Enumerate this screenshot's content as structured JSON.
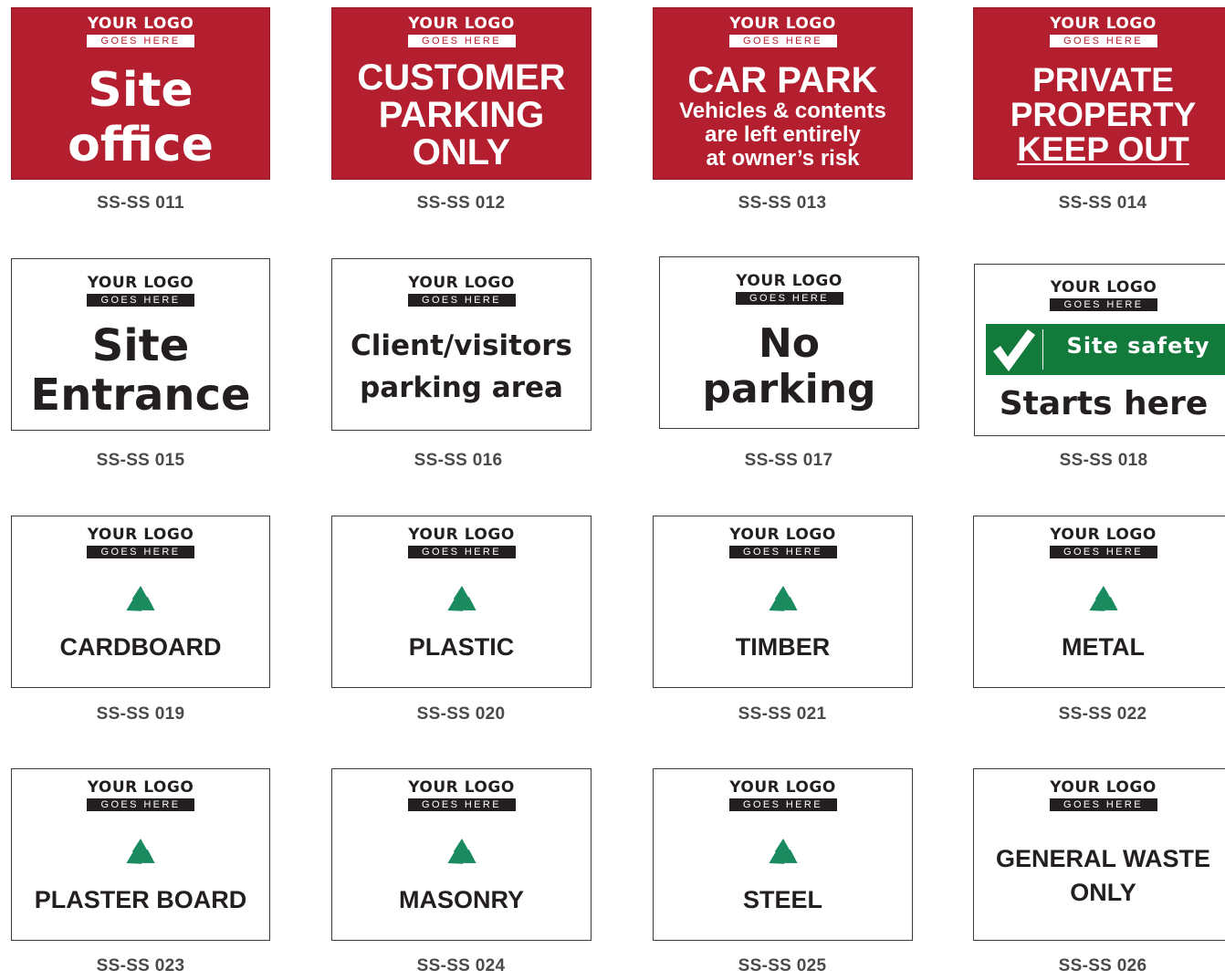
{
  "logo": {
    "line1": "YOUR LOGO",
    "line2": "GOES HERE"
  },
  "colors": {
    "red": "#b41f2f",
    "green": "#127a3b",
    "recycle": "#1a8a5f",
    "text": "#231f20"
  },
  "signs": [
    {
      "code": "SS-SS 011",
      "lines": [
        "Site",
        "office"
      ]
    },
    {
      "code": "SS-SS 012",
      "lines": [
        "CUSTOMER",
        "PARKING",
        "ONLY"
      ]
    },
    {
      "code": "SS-SS 013",
      "lines": [
        "CAR PARK",
        "Vehicles & contents",
        "are left entirely",
        "at owner’s risk"
      ]
    },
    {
      "code": "SS-SS 014",
      "lines": [
        "PRIVATE",
        "PROPERTY",
        "KEEP OUT"
      ]
    },
    {
      "code": "SS-SS 015",
      "lines": [
        "Site",
        "Entrance"
      ]
    },
    {
      "code": "SS-SS 016",
      "lines": [
        "Client/visitors",
        "parking area"
      ]
    },
    {
      "code": "SS-SS 017",
      "lines": [
        "No",
        "parking"
      ]
    },
    {
      "code": "SS-SS 018",
      "banner": "Site safety",
      "lines": [
        "Starts here"
      ],
      "icon": "checkmark-icon"
    },
    {
      "code": "SS-SS 019",
      "lines": [
        "CARDBOARD"
      ],
      "icon": "recycle-icon"
    },
    {
      "code": "SS-SS 020",
      "lines": [
        "PLASTIC"
      ],
      "icon": "recycle-icon"
    },
    {
      "code": "SS-SS 021",
      "lines": [
        "TIMBER"
      ],
      "icon": "recycle-icon"
    },
    {
      "code": "SS-SS 022",
      "lines": [
        "METAL"
      ],
      "icon": "recycle-icon"
    },
    {
      "code": "SS-SS 023",
      "lines": [
        "PLASTER BOARD"
      ],
      "icon": "recycle-icon"
    },
    {
      "code": "SS-SS 024",
      "lines": [
        "MASONRY"
      ],
      "icon": "recycle-icon"
    },
    {
      "code": "SS-SS 025",
      "lines": [
        "STEEL"
      ],
      "icon": "recycle-icon"
    },
    {
      "code": "SS-SS 026",
      "lines": [
        "GENERAL WASTE",
        "ONLY"
      ]
    }
  ]
}
